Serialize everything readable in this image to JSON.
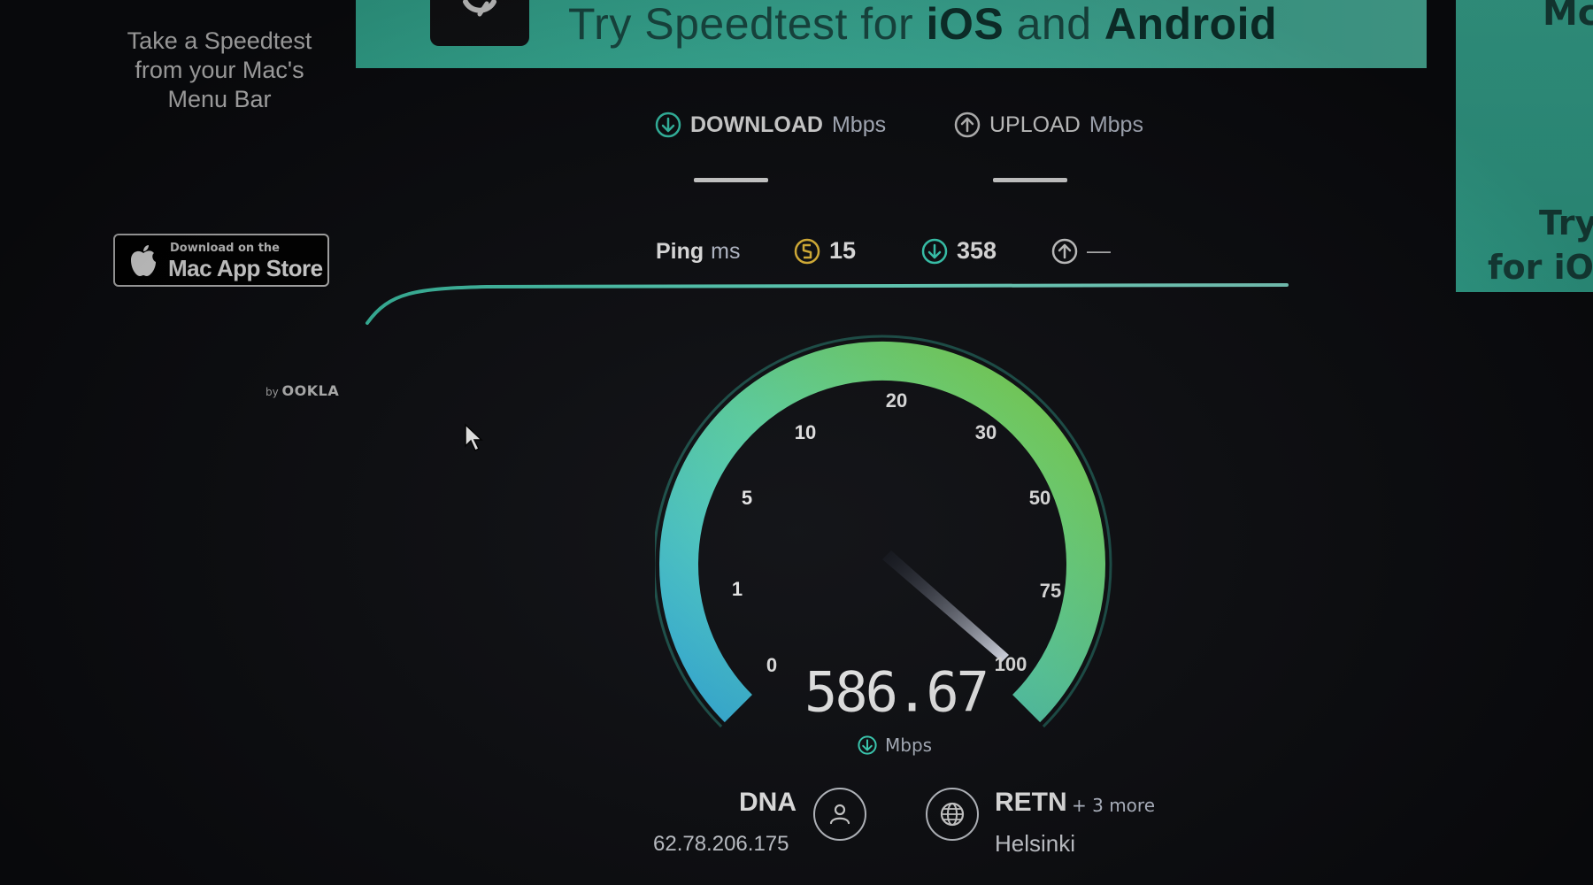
{
  "banner": {
    "text_prefix": "Try Speedtest for ",
    "text_ios": "iOS",
    "text_and": " and ",
    "text_android": "Android"
  },
  "side_ad": {
    "line1": "Mc",
    "line2": "Try",
    "line3": "for iOS"
  },
  "promo": {
    "text_line1": "Take a Speedtest",
    "text_line2": "from your Mac's",
    "text_line3": "Menu Bar",
    "appstore_small": "Download on the",
    "appstore_big": "Mac App Store",
    "by_label": "by",
    "brand": "OOKLA"
  },
  "tabs": {
    "download_label": "DOWNLOAD",
    "download_unit": "Mbps",
    "upload_label": "UPLOAD",
    "upload_unit": "Mbps"
  },
  "ping": {
    "label": "Ping",
    "unit": "ms",
    "idle": "15",
    "download": "358",
    "upload": "—"
  },
  "gauge": {
    "ticks": [
      "0",
      "1",
      "5",
      "10",
      "20",
      "30",
      "50",
      "75",
      "100"
    ],
    "value": "586.67",
    "unit": "Mbps"
  },
  "isp": {
    "name": "DNA",
    "ip": "62.78.206.175"
  },
  "server": {
    "name": "RETN",
    "more": "+ 3 more",
    "city": "Helsinki"
  },
  "colors": {
    "accent_teal": "#3fd1b3",
    "gauge_start": "#36b6e6",
    "gauge_end": "#86e04a",
    "background": "#0d0e12"
  }
}
